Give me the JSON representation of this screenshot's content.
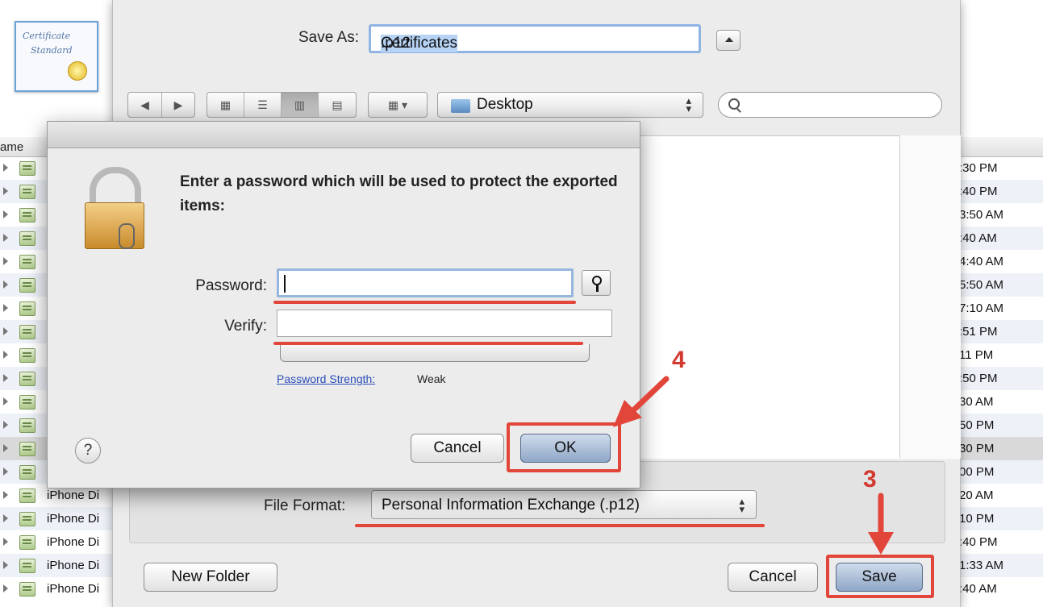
{
  "background_list": {
    "column_header": "ame",
    "rows": [
      {
        "name": "",
        "time": ":30 PM"
      },
      {
        "name": "",
        "time": ":40 PM"
      },
      {
        "name": "",
        "time": "3:50 AM"
      },
      {
        "name": "",
        "time": ":40 AM"
      },
      {
        "name": "",
        "time": "4:40 AM"
      },
      {
        "name": "",
        "time": "5:50 AM"
      },
      {
        "name": "",
        "time": "7:10 AM"
      },
      {
        "name": "",
        "time": ":51 PM"
      },
      {
        "name": "",
        "time": "11 PM"
      },
      {
        "name": "",
        "time": ":50 PM"
      },
      {
        "name": "",
        "time": "30 AM"
      },
      {
        "name": "",
        "time": "50 PM"
      },
      {
        "name": "",
        "time": "30 PM"
      },
      {
        "name": "",
        "time": "00 PM"
      },
      {
        "name": "iPhone Di",
        "time": "20 AM"
      },
      {
        "name": "iPhone Di",
        "time": "10 PM"
      },
      {
        "name": "iPhone Di",
        "time": ":40 PM"
      },
      {
        "name": "iPhone Di",
        "time": "1:33 AM"
      },
      {
        "name": "iPhone Di",
        "time": ":40 AM"
      }
    ]
  },
  "certificate_icon": {
    "text_line1": "Certificate",
    "text_line2": "Standard"
  },
  "save_sheet": {
    "save_as_label": "Save As:",
    "filename_base": "Certificates",
    "filename_ext": ".p12",
    "location": "Desktop",
    "search_placeholder": "",
    "file_format_label": "File Format:",
    "file_format_value": "Personal Information Exchange (.p12)",
    "new_folder_label": "New Folder",
    "cancel_label": "Cancel",
    "save_label": "Save"
  },
  "password_dialog": {
    "message": "Enter a password which will be used to protect the exported items:",
    "password_label": "Password:",
    "password_value": "",
    "verify_label": "Verify:",
    "verify_value": "",
    "strength_link": "Password Strength:",
    "strength_value": "Weak",
    "help_label": "?",
    "cancel_label": "Cancel",
    "ok_label": "OK"
  },
  "annotations": {
    "step4": "4",
    "step3": "3",
    "color": "#e2463a"
  }
}
